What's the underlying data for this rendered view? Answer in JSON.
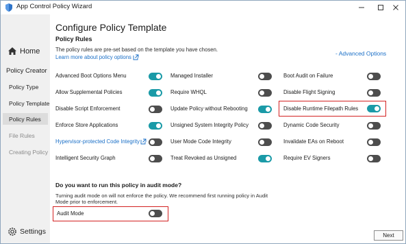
{
  "window": {
    "title": "App Control Policy Wizard",
    "accent_color": "#1a9aa7",
    "link_color": "#1a6fc7",
    "highlight_color": "#d32020"
  },
  "sidebar": {
    "home_label": "Home",
    "header": "Policy Creator",
    "items": [
      {
        "label": "Policy Type",
        "state": "enabled"
      },
      {
        "label": "Policy Template",
        "state": "enabled"
      },
      {
        "label": "Policy Rules",
        "state": "active"
      },
      {
        "label": "File Rules",
        "state": "disabled"
      },
      {
        "label": "Creating Policy",
        "state": "disabled"
      }
    ],
    "settings_label": "Settings"
  },
  "main": {
    "title": "Configure Policy Template",
    "section_title": "Policy Rules",
    "description": "The policy rules are pre-set based on the template you have chosen.",
    "learn_more": "Learn more about policy options",
    "advanced_options": "- Advanced Options",
    "rules": [
      {
        "label": "Advanced Boot Options Menu",
        "on": true
      },
      {
        "label": "Managed Installer",
        "on": false
      },
      {
        "label": "Boot Audit on Failure",
        "on": false
      },
      {
        "label": "Allow Supplemental Policies",
        "on": true
      },
      {
        "label": "Require WHQL",
        "on": false
      },
      {
        "label": "Disable Flight Signing",
        "on": false
      },
      {
        "label": "Disable Script Enforcement",
        "on": false
      },
      {
        "label": "Update Policy without Rebooting",
        "on": true
      },
      {
        "label": "Disable Runtime Filepath Rules",
        "on": true
      },
      {
        "label": "Enforce Store Applications",
        "on": true
      },
      {
        "label": "Unsigned System Integrity Policy",
        "on": false
      },
      {
        "label": "Dynamic Code Security",
        "on": false
      },
      {
        "label": "Hypervisor-protected Code Integrity",
        "on": false
      },
      {
        "label": "User Mode Code Integrity",
        "on": false
      },
      {
        "label": "Invalidate EAs on Reboot",
        "on": false
      },
      {
        "label": "Intelligent Security Graph",
        "on": false
      },
      {
        "label": "Treat Revoked as Unsigned",
        "on": true
      },
      {
        "label": "Require EV Signers",
        "on": false
      }
    ],
    "audit": {
      "question": "Do you want to run this policy in audit mode?",
      "description": "Turning audit mode on will not enforce the policy. We recommend first running policy in Audit Mode prior to enforcement.",
      "label": "Audit Mode",
      "on": false
    },
    "next_label": "Next"
  }
}
